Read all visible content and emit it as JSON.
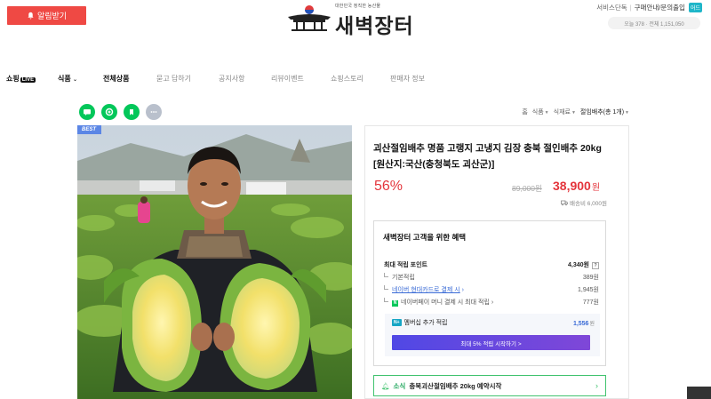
{
  "header": {
    "alarm_button": "알림받기",
    "logo_tagline": "대한민국 정직한 농산물",
    "logo_title": "새벽장터",
    "top_links": [
      "서비스단독",
      "구매안내/문의출입"
    ],
    "top_chip": "어드",
    "stats": "오늘 378 · 전체 1,151,050"
  },
  "nav": {
    "items": [
      {
        "label": "쇼핑",
        "badge": "LIVE"
      },
      {
        "label": "식품"
      },
      {
        "label": "전체상품"
      },
      {
        "label": "묻고 답하기"
      },
      {
        "label": "공지사항"
      },
      {
        "label": "리뷰이벤트"
      },
      {
        "label": "쇼핑스토리"
      },
      {
        "label": "판매자 정보"
      }
    ]
  },
  "breadcrumb": [
    "홈",
    "식품",
    "식재료",
    "절임배추(총 1개)"
  ],
  "product": {
    "badge": "BEST",
    "title": "괴산절임배추 명품 고랭지 고냉지 김장 충북 절인배추 20kg [원산지:국산(충청북도 괴산군)]",
    "discount": "56%",
    "original_price": "89,000원",
    "sale_price": "38,900",
    "sale_unit": "원",
    "shipping": "배송비 6,000원"
  },
  "benefits": {
    "title": "새벽장터 고객을 위한 혜택",
    "max_points_label": "최대 적립 포인트",
    "max_points_value": "4,340원",
    "basic_label": "기본적립",
    "basic_value": "389원",
    "card_label": "네이버 현대카드로 결제 시",
    "card_value": "1,945원",
    "npay_label": "네이버페이 머니 결제 시 최대 적립",
    "npay_value": "777원",
    "member_tag": "N+",
    "member_label": "멤버십 추가 적립",
    "member_value": "1,556",
    "member_unit": "원",
    "member_button": "최대 5% 적립 시작하기 >"
  },
  "reserve": {
    "news": "소식",
    "text": "충북괴산절임배추 20kg 예약시작"
  },
  "colors": {
    "accent_red": "#e4353c",
    "npay_green": "#03c75a",
    "member_purple": "#5048e5"
  }
}
